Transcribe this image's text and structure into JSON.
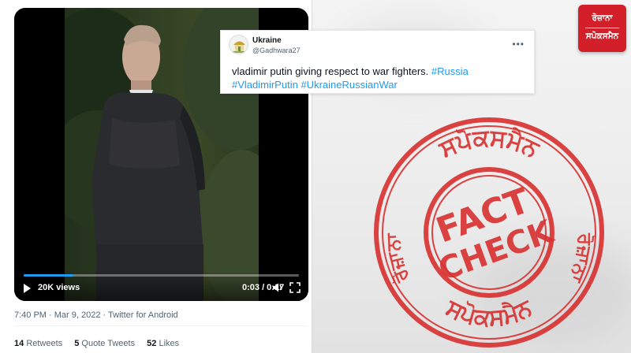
{
  "video": {
    "views": "20K views",
    "time": "0:03 / 0:17",
    "progress": 0.18
  },
  "tweet_meta": {
    "timestamp": "7:40 PM · Mar 9, 2022 · Twitter for Android"
  },
  "stats": {
    "retweets_count": "14",
    "retweets_label": "Retweets",
    "quotes_count": "5",
    "quotes_label": "Quote Tweets",
    "likes_count": "52",
    "likes_label": "Likes"
  },
  "embedded_tweet": {
    "name": "Ukraine",
    "handle": "@Gadhwara27",
    "text": "vladimir putin giving respect to war fighters.",
    "hashtags": [
      "#Russia",
      "#VladimirPutin",
      "#UkraineRussianWar"
    ]
  },
  "logo": {
    "line1": "ਰੋਜ਼ਾਨਾ",
    "line2": "ਸਪੋਕਸਮੈਨ"
  },
  "stamp": {
    "top_arc": "ਸਪੋਕਸਮੈਨ",
    "left_arc": "ਰੋਜ਼ਾਨਾ",
    "right_arc": "ਰੋਜ਼ਾਨਾ",
    "bottom_arc": "ਸਪੋਕਸਮੈਨ",
    "word1": "FACT",
    "word2": "CHECK"
  },
  "colors": {
    "stamp_red": "#d8302f",
    "link_blue": "#1d9bf0",
    "logo_red": "#d31f2a"
  }
}
